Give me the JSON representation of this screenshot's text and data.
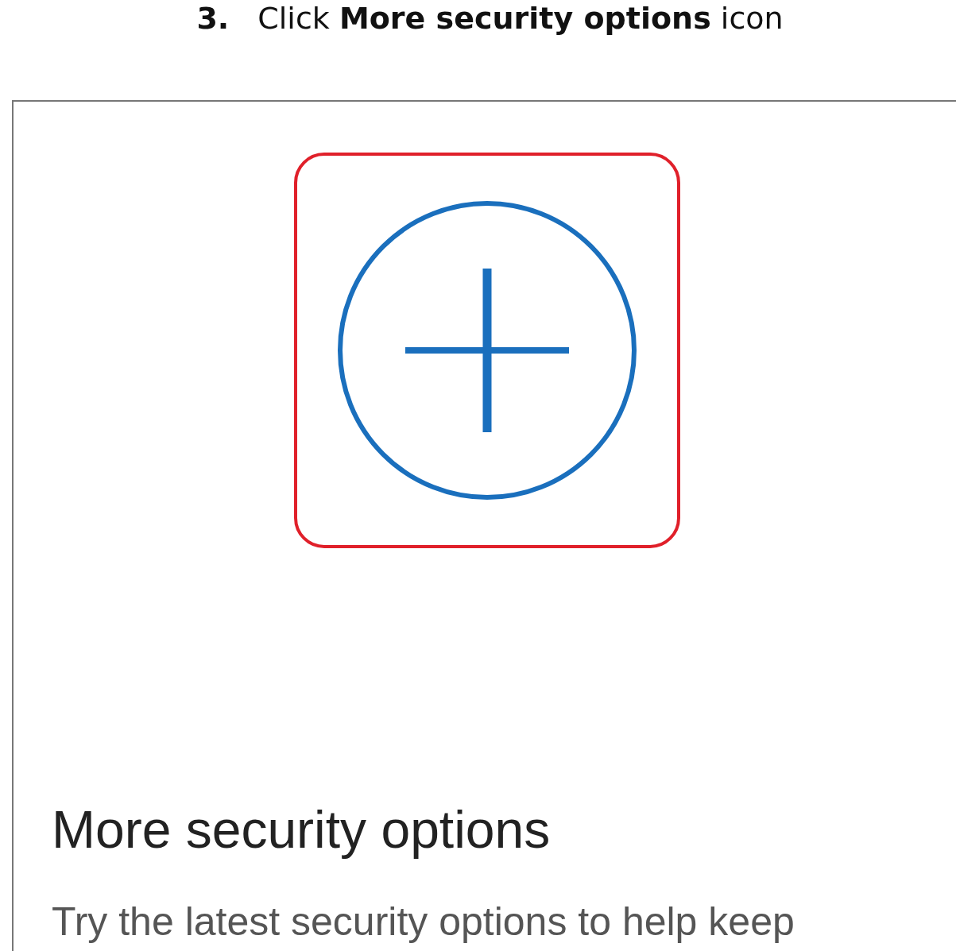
{
  "step": {
    "number": "3.",
    "text": "Click **More security options** icon"
  },
  "card": {
    "icon_highlighted": true,
    "title": "More security options",
    "description": "Try the latest security options to help keep"
  }
}
